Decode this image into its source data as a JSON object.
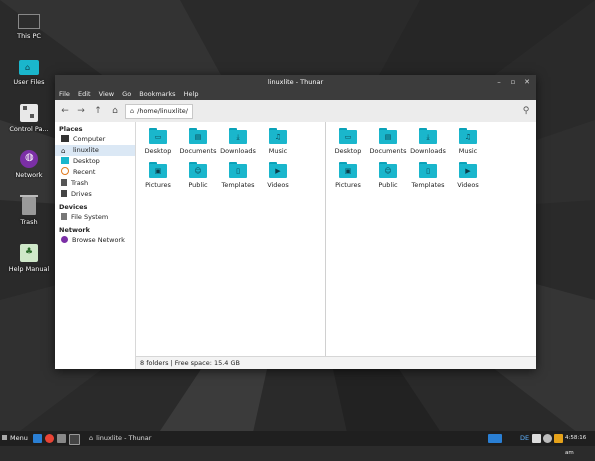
{
  "desktop": {
    "icons": [
      {
        "label": "This PC"
      },
      {
        "label": "User Files"
      },
      {
        "label": "Control Pa..."
      },
      {
        "label": "Network"
      },
      {
        "label": "Trash"
      },
      {
        "label": "Help Manual"
      }
    ]
  },
  "window": {
    "title": "linuxlite - Thunar",
    "menu": [
      "File",
      "Edit",
      "View",
      "Go",
      "Bookmarks",
      "Help"
    ],
    "path": "/home/linuxlite/",
    "sidebar": {
      "places_label": "Places",
      "places": [
        "Computer",
        "linuxlite",
        "Desktop",
        "Recent",
        "Trash",
        "Drives"
      ],
      "devices_label": "Devices",
      "devices": [
        "File System"
      ],
      "network_label": "Network",
      "network": [
        "Browse Network"
      ]
    },
    "folders": [
      "Desktop",
      "Documents",
      "Downloads",
      "Music",
      "Pictures",
      "Public",
      "Templates",
      "Videos"
    ],
    "status": "8 folders  |  Free space: 15.4 GB"
  },
  "taskbar": {
    "menu_label": "Menu",
    "task_label": "linuxlite - Thunar",
    "keyboard_layout": "DE",
    "clock": "4:58:16 am"
  },
  "colors": {
    "folder": "#1ab6cc",
    "accent": "#0aa2b8"
  }
}
